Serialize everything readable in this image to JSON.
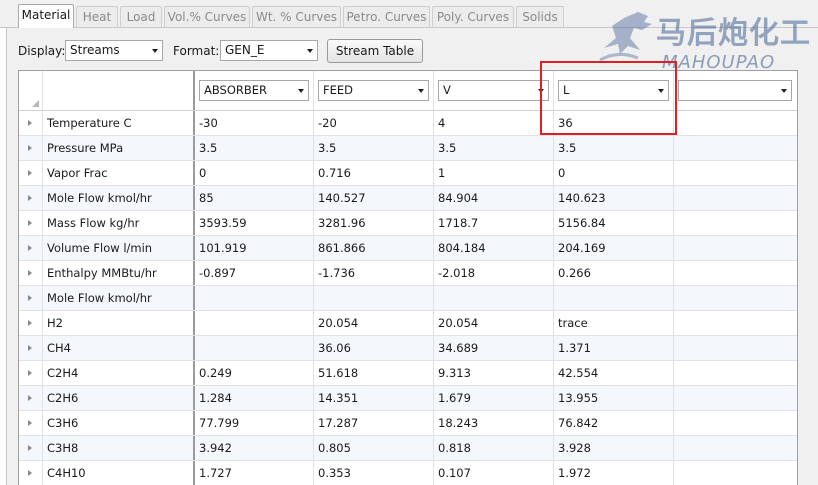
{
  "tabs": [
    "Material",
    "Heat",
    "Load",
    "Vol.% Curves",
    "Wt. % Curves",
    "Petro. Curves",
    "Poly. Curves",
    "Solids"
  ],
  "active_tab": "Material",
  "toolbar": {
    "display_label": "Display:",
    "display_value": "Streams",
    "format_label": "Format:",
    "format_value": "GEN_E",
    "stream_table_button": "Stream Table"
  },
  "columns": [
    "ABSORBER",
    "FEED",
    "V",
    "L",
    ""
  ],
  "rows": [
    {
      "label": "Temperature C",
      "values": [
        "-30",
        "-20",
        "4",
        "36",
        ""
      ]
    },
    {
      "label": "Pressure MPa",
      "values": [
        "3.5",
        "3.5",
        "3.5",
        "3.5",
        ""
      ]
    },
    {
      "label": "Vapor Frac",
      "values": [
        "0",
        "0.716",
        "1",
        "0",
        ""
      ]
    },
    {
      "label": "Mole Flow kmol/hr",
      "values": [
        "85",
        "140.527",
        "84.904",
        "140.623",
        ""
      ]
    },
    {
      "label": "Mass Flow kg/hr",
      "values": [
        "3593.59",
        "3281.96",
        "1718.7",
        "5156.84",
        ""
      ]
    },
    {
      "label": "Volume Flow l/min",
      "values": [
        "101.919",
        "861.866",
        "804.184",
        "204.169",
        ""
      ]
    },
    {
      "label": "Enthalpy   MMBtu/hr",
      "values": [
        "-0.897",
        "-1.736",
        "-2.018",
        "0.266",
        ""
      ]
    },
    {
      "label": "Mole Flow kmol/hr",
      "values": [
        "",
        "",
        "",
        "",
        ""
      ]
    },
    {
      "label": "H2",
      "values": [
        "",
        "20.054",
        "20.054",
        "trace",
        ""
      ]
    },
    {
      "label": "CH4",
      "values": [
        "",
        "36.06",
        "34.689",
        "1.371",
        ""
      ]
    },
    {
      "label": "C2H4",
      "values": [
        "0.249",
        "51.618",
        "9.313",
        "42.554",
        ""
      ]
    },
    {
      "label": "C2H6",
      "values": [
        "1.284",
        "14.351",
        "1.679",
        "13.955",
        ""
      ]
    },
    {
      "label": "C3H6",
      "values": [
        "77.799",
        "17.287",
        "18.243",
        "76.842",
        ""
      ]
    },
    {
      "label": "C3H8",
      "values": [
        "3.942",
        "0.805",
        "0.818",
        "3.928",
        ""
      ]
    },
    {
      "label": "C4H10",
      "values": [
        "1.727",
        "0.353",
        "0.107",
        "1.972",
        ""
      ]
    }
  ],
  "watermark": {
    "chinese": "马后炮化工",
    "english": "MAHOUPAO"
  },
  "colors": {
    "highlight": "#e02020",
    "selected_tab_bg": "#ffffff",
    "panel_bg": "#f0f0f0"
  }
}
